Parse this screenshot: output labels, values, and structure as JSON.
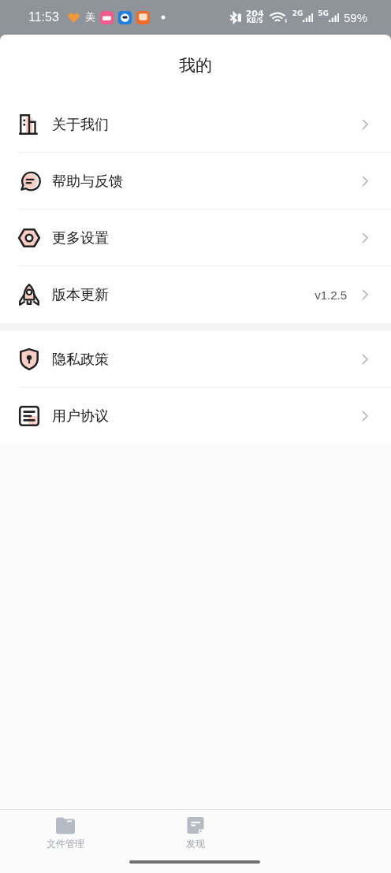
{
  "status_bar": {
    "time": "11:53",
    "meituan_label": "美",
    "speed": "204",
    "speed_unit": "KB/S",
    "net_1": "2G",
    "net_2": "5G",
    "battery": "59%"
  },
  "header": {
    "title": "我的"
  },
  "menu_groups": [
    {
      "items": [
        {
          "label": "关于我们"
        },
        {
          "label": "帮助与反馈"
        },
        {
          "label": "更多设置"
        },
        {
          "label": "版本更新",
          "value": "v1.2.5"
        }
      ]
    },
    {
      "items": [
        {
          "label": "隐私政策"
        },
        {
          "label": "用户协议"
        }
      ]
    }
  ],
  "tab_bar": [
    {
      "label": "文件管理"
    },
    {
      "label": "发现"
    }
  ]
}
